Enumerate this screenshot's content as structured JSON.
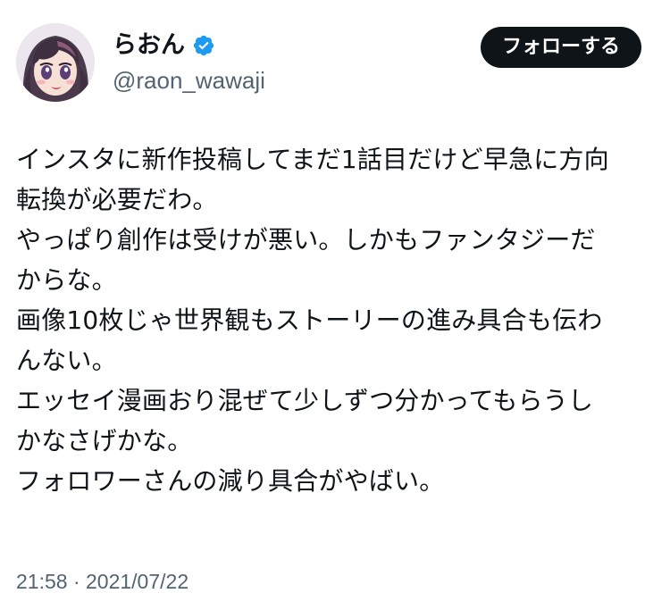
{
  "user": {
    "display_name": "らおん",
    "handle": "@raon_wawaji",
    "verified_icon": "verified-badge-icon",
    "avatar_icon": "anime-girl-avatar"
  },
  "follow_button": {
    "label": "フォローする"
  },
  "tweet": {
    "lines": [
      "インスタに新作投稿してまだ1話目だけど早急に方向",
      "転換が必要だわ。",
      "やっぱり創作は受けが悪い。しかもファンタジーだ",
      "からな。",
      "画像10枚じゃ世界観もストーリーの進み具合も伝わ",
      "んない。",
      "エッセイ漫画おり混ぜて少しずつ分かってもらうし",
      "かなさげかな。",
      "フォロワーさんの減り具合がやばい。"
    ],
    "timestamp": "21:58 · 2021/07/22"
  },
  "colors": {
    "text": "#0f1419",
    "secondary": "#536471",
    "verified": "#1d9bf0",
    "button_bg": "#0f1419",
    "button_text": "#ffffff"
  }
}
